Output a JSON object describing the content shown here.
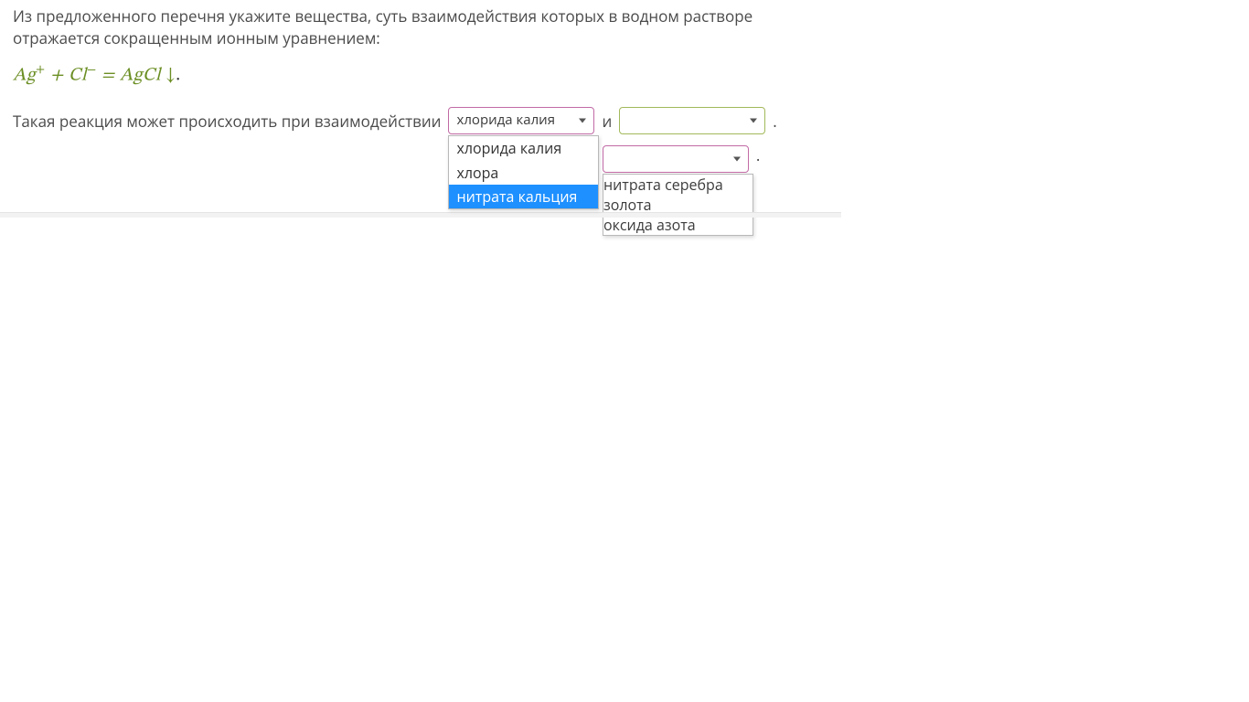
{
  "question": {
    "intro": "Из предложенного перечня укажите вещества, суть взаимодействия которых  в водном растворе отражается сокращенным ионным уравнением:",
    "equation_parts": {
      "ag": "Ag",
      "plus_sup": "+",
      "plus": " + ",
      "cl": "Cl",
      "minus_sup": "−",
      "eq": " = ",
      "agcl": "AgCl ",
      "arrow": "↓",
      "dot": "."
    },
    "sentence_lead": "Такая реакция может происходить при взаимодействии",
    "connector": "и",
    "tail": "."
  },
  "select1": {
    "value": "хлорида калия",
    "options": [
      "хлорида калия",
      "хлора",
      "нитрата кальция"
    ],
    "highlighted_index": 2
  },
  "select2": {
    "value": "",
    "options": [
      "нитрата серебра",
      "золота",
      "оксида азота"
    ],
    "highlighted_index": -1
  }
}
